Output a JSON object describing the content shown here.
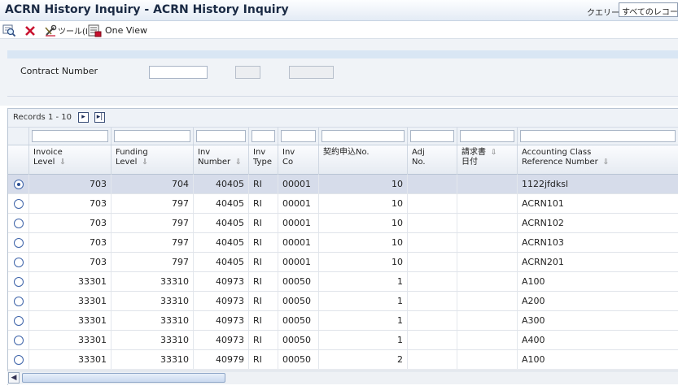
{
  "window": {
    "title": "ACRN History Inquiry - ACRN History Inquiry",
    "query_label": "クエリー:",
    "query_value": "すべてのレコード"
  },
  "toolbar": {
    "tools_label": "ツール(I)",
    "one_view_label": "One View"
  },
  "form": {
    "contract_number_label": "Contract Number",
    "contract_number_value": ""
  },
  "grid": {
    "records_label": "Records 1 - 10",
    "columns": [
      {
        "label_line1": "Invoice",
        "label_line2": "Level",
        "sortable": true
      },
      {
        "label_line1": "Funding",
        "label_line2": "Level",
        "sortable": true
      },
      {
        "label_line1": "Inv",
        "label_line2": "Number",
        "sortable": true
      },
      {
        "label_line1": "Inv",
        "label_line2": "Type",
        "sortable": false
      },
      {
        "label_line1": "Inv",
        "label_line2": "Co",
        "sortable": false
      },
      {
        "label_line1": "契約申込No.",
        "label_line2": "",
        "sortable": false
      },
      {
        "label_line1": "Adj",
        "label_line2": "No.",
        "sortable": false
      },
      {
        "label_line1": "請求書",
        "label_line2": "日付",
        "sortable": true
      },
      {
        "label_line1": "Accounting Class",
        "label_line2": "Reference Number",
        "sortable": true
      }
    ],
    "rows": [
      {
        "selected": true,
        "invoice_level": "703",
        "funding_level": "704",
        "inv_number": "40405",
        "inv_type": "RI",
        "inv_co": "00001",
        "contract_no": "10",
        "adj_no": "",
        "invoice_date": "",
        "acct_ref": "1122jfdksl"
      },
      {
        "selected": false,
        "invoice_level": "703",
        "funding_level": "797",
        "inv_number": "40405",
        "inv_type": "RI",
        "inv_co": "00001",
        "contract_no": "10",
        "adj_no": "",
        "invoice_date": "",
        "acct_ref": "ACRN101"
      },
      {
        "selected": false,
        "invoice_level": "703",
        "funding_level": "797",
        "inv_number": "40405",
        "inv_type": "RI",
        "inv_co": "00001",
        "contract_no": "10",
        "adj_no": "",
        "invoice_date": "",
        "acct_ref": "ACRN102"
      },
      {
        "selected": false,
        "invoice_level": "703",
        "funding_level": "797",
        "inv_number": "40405",
        "inv_type": "RI",
        "inv_co": "00001",
        "contract_no": "10",
        "adj_no": "",
        "invoice_date": "",
        "acct_ref": "ACRN103"
      },
      {
        "selected": false,
        "invoice_level": "703",
        "funding_level": "797",
        "inv_number": "40405",
        "inv_type": "RI",
        "inv_co": "00001",
        "contract_no": "10",
        "adj_no": "",
        "invoice_date": "",
        "acct_ref": "ACRN201"
      },
      {
        "selected": false,
        "invoice_level": "33301",
        "funding_level": "33310",
        "inv_number": "40973",
        "inv_type": "RI",
        "inv_co": "00050",
        "contract_no": "1",
        "adj_no": "",
        "invoice_date": "",
        "acct_ref": "A100"
      },
      {
        "selected": false,
        "invoice_level": "33301",
        "funding_level": "33310",
        "inv_number": "40973",
        "inv_type": "RI",
        "inv_co": "00050",
        "contract_no": "1",
        "adj_no": "",
        "invoice_date": "",
        "acct_ref": "A200"
      },
      {
        "selected": false,
        "invoice_level": "33301",
        "funding_level": "33310",
        "inv_number": "40973",
        "inv_type": "RI",
        "inv_co": "00050",
        "contract_no": "1",
        "adj_no": "",
        "invoice_date": "",
        "acct_ref": "A300"
      },
      {
        "selected": false,
        "invoice_level": "33301",
        "funding_level": "33310",
        "inv_number": "40973",
        "inv_type": "RI",
        "inv_co": "00050",
        "contract_no": "1",
        "adj_no": "",
        "invoice_date": "",
        "acct_ref": "A400"
      },
      {
        "selected": false,
        "invoice_level": "33301",
        "funding_level": "33310",
        "inv_number": "40979",
        "inv_type": "RI",
        "inv_co": "00050",
        "contract_no": "2",
        "adj_no": "",
        "invoice_date": "",
        "acct_ref": "A100"
      }
    ]
  },
  "icons": {
    "find": "find-icon",
    "delete": "close-icon",
    "tools": "tools-icon",
    "one_view": "one-view-icon",
    "next": "chevron-right-icon",
    "last": "chevron-last-icon"
  },
  "colors": {
    "selected_row": "#d6dcea",
    "delete_red": "#c8102e",
    "title_text": "#1a2a44"
  }
}
